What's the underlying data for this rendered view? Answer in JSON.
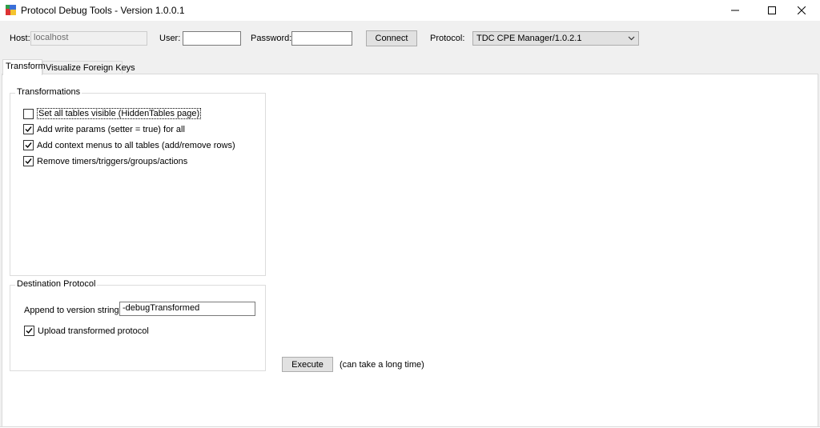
{
  "window": {
    "title": "Protocol Debug Tools - Version 1.0.0.1",
    "controls": {
      "minimize": "—",
      "maximize": "☐",
      "close": "✕"
    }
  },
  "connection": {
    "host_label": "Host:",
    "host_value": "localhost",
    "user_label": "User:",
    "user_value": "",
    "password_label": "Password:",
    "password_value": "",
    "connect_label": "Connect",
    "protocol_label": "Protocol:",
    "protocol_value": "TDC CPE Manager/1.0.2.1"
  },
  "tabs": [
    {
      "label": "Transform",
      "active": true
    },
    {
      "label": "Visualize Foreign Keys",
      "active": false
    }
  ],
  "transformations": {
    "title": "Transformations",
    "options": [
      {
        "label": "Set all tables visible (HiddenTables page)",
        "checked": false
      },
      {
        "label": "Add write params (setter = true) for all",
        "checked": true
      },
      {
        "label": "Add context menus to all tables (add/remove rows)",
        "checked": true
      },
      {
        "label": "Remove timers/triggers/groups/actions",
        "checked": true
      }
    ]
  },
  "destination": {
    "title": "Destination Protocol",
    "append_label": "Append to version string:",
    "append_value": "-debugTransformed",
    "upload_label": "Upload transformed protocol",
    "upload_checked": true
  },
  "execute": {
    "button_label": "Execute",
    "note": "(can take a long time)"
  }
}
